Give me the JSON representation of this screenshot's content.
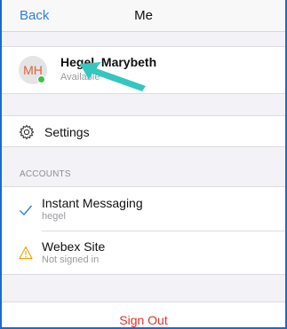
{
  "navbar": {
    "back_label": "Back",
    "title": "Me"
  },
  "profile": {
    "initials": "MH",
    "name": "Hegel, Marybeth",
    "status": "Available",
    "presence_color": "#3fbf4a"
  },
  "settings": {
    "label": "Settings",
    "icon": "gear-icon"
  },
  "accounts": {
    "header": "ACCOUNTS",
    "items": [
      {
        "title": "Instant Messaging",
        "subtitle": "hegel",
        "icon": "checkmark-icon",
        "icon_color": "#2f7fd8"
      },
      {
        "title": "Webex Site",
        "subtitle": "Not signed in",
        "icon": "warning-icon",
        "icon_color": "#f0a500"
      }
    ]
  },
  "sign_out": {
    "label": "Sign Out",
    "color": "#e0322b"
  },
  "colors": {
    "accent": "#2f7fd8",
    "frame_border": "#1b6ac9",
    "annotation_arrow": "#35c6c0"
  }
}
